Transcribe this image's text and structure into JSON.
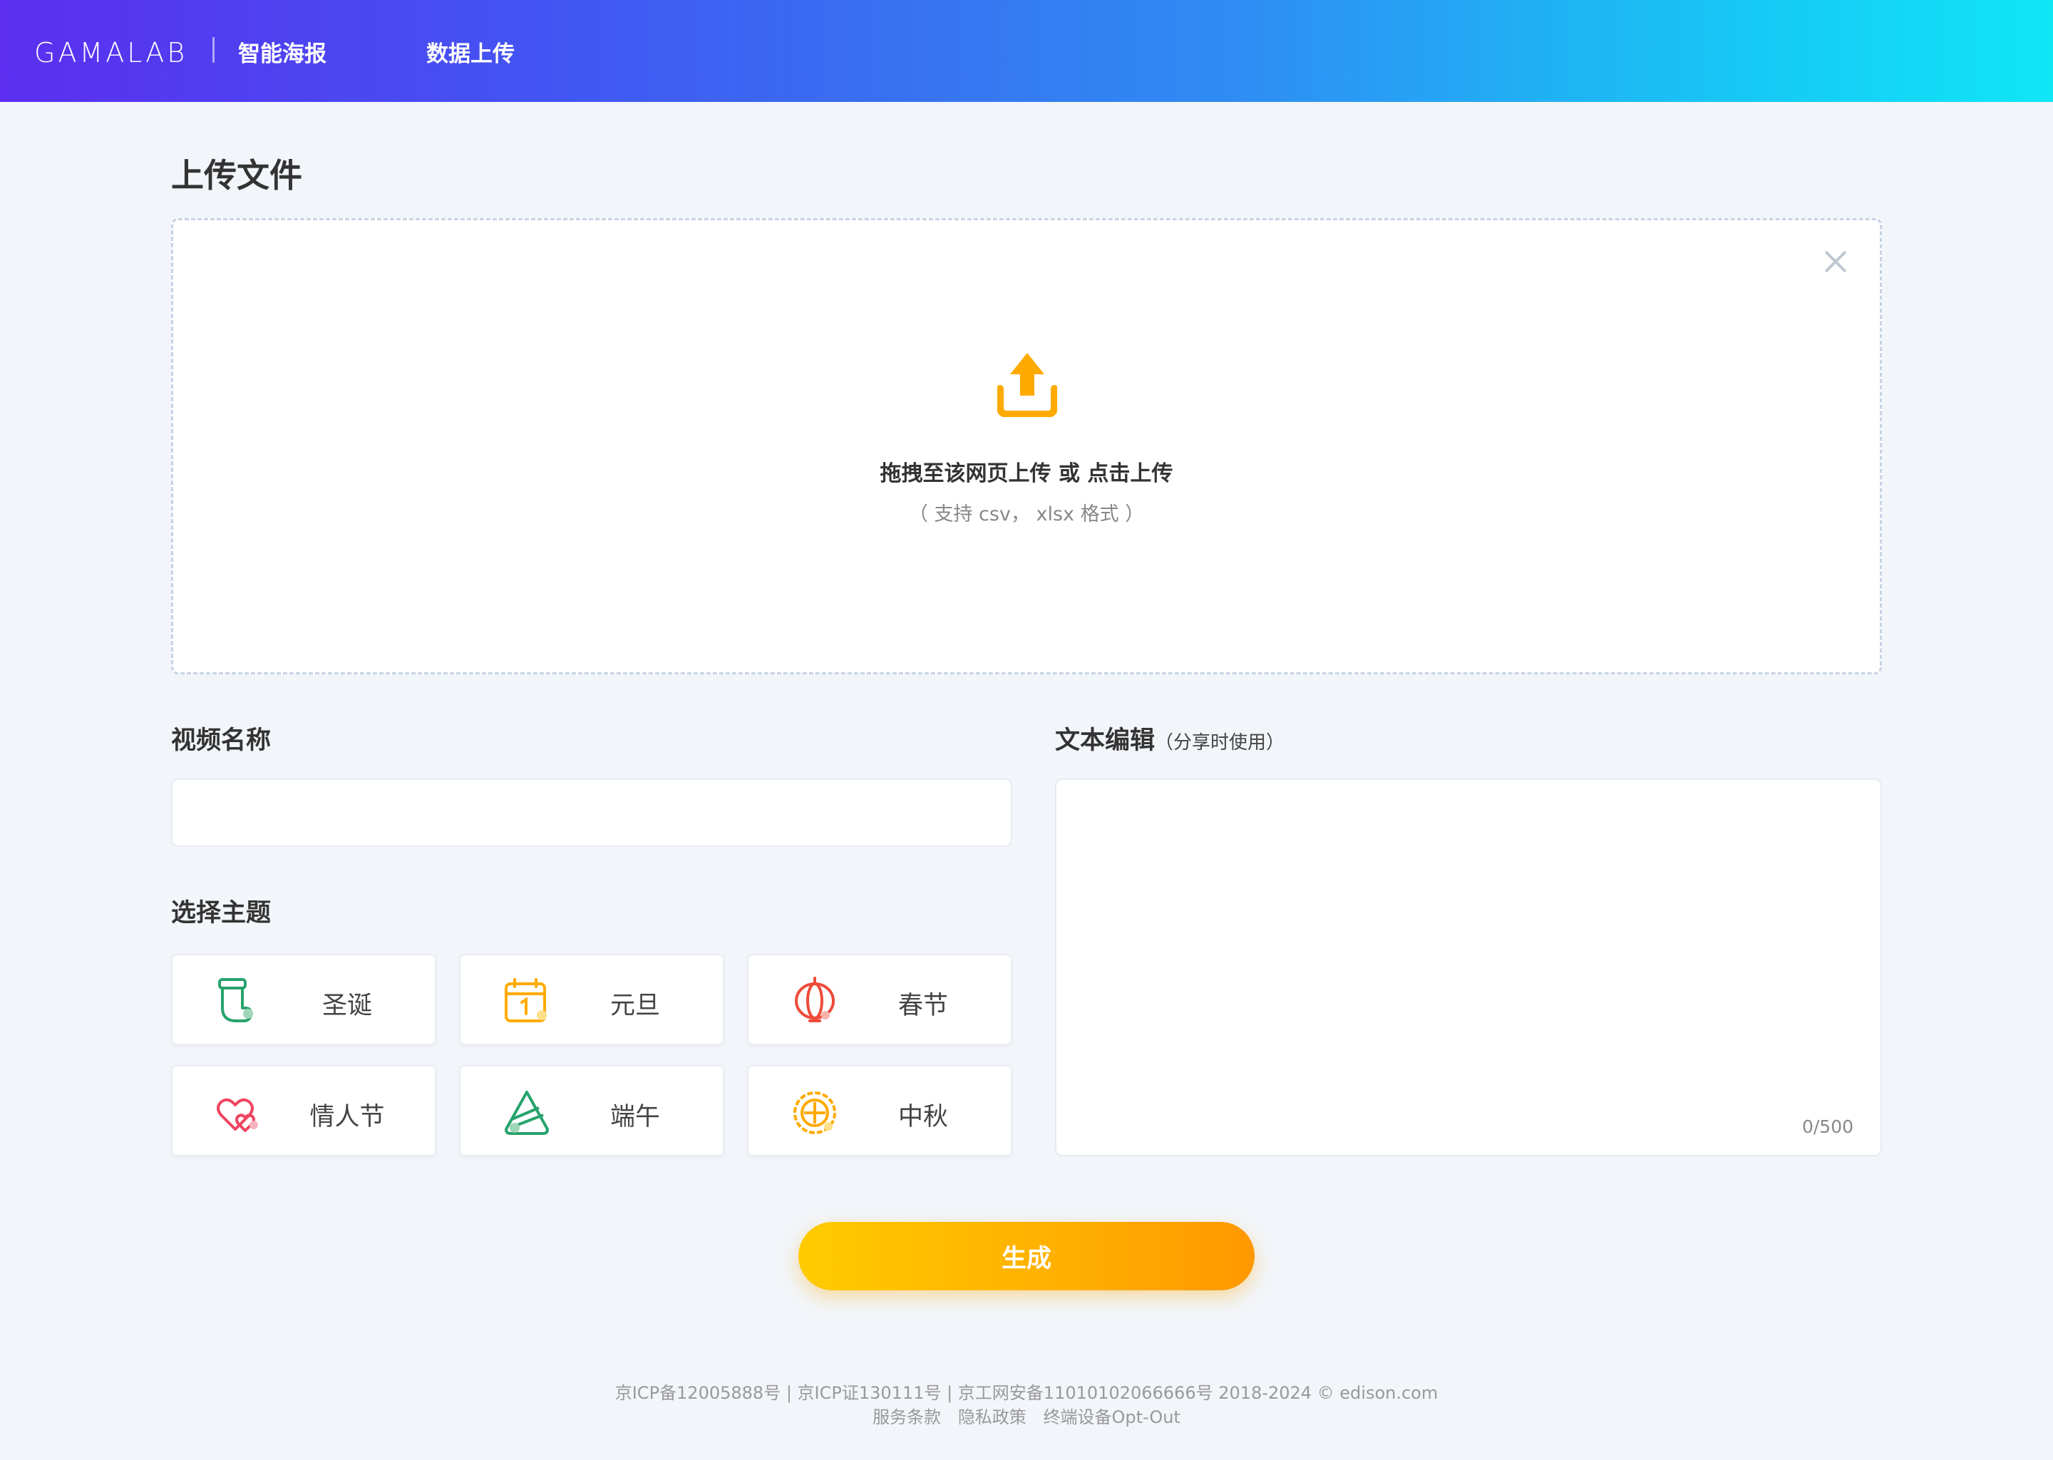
{
  "header": {
    "logo": "GAMALAB",
    "brand": "智能海报",
    "nav_upload": "数据上传"
  },
  "main": {
    "title": "上传文件",
    "dropzone": {
      "hint": "拖拽至该网页上传 或 点击上传",
      "formats": "（ 支持 csv， xlsx 格式 ）",
      "icon": "upload-icon",
      "accent": "#ffaa00"
    },
    "video_name": {
      "label": "视频名称",
      "value": "",
      "placeholder": ""
    },
    "text_edit": {
      "label": "文本编辑",
      "sub": "（分享时使用）",
      "value": "",
      "counter": "0/500"
    },
    "theme": {
      "label": "选择主题",
      "items": [
        {
          "label": "圣诞",
          "icon": "stocking-icon"
        },
        {
          "label": "元旦",
          "icon": "calendar-icon"
        },
        {
          "label": "春节",
          "icon": "lantern-icon"
        },
        {
          "label": "情人节",
          "icon": "hearts-icon"
        },
        {
          "label": "端午",
          "icon": "zongzi-icon"
        },
        {
          "label": "中秋",
          "icon": "mooncake-icon"
        }
      ]
    },
    "generate_label": "生成"
  },
  "footer": {
    "line1": "京ICP备12005888号 | 京ICP证130111号 | 京工网安备11010102066666号 2018-2024 © edison.com",
    "links": [
      "服务条款",
      "隐私政策",
      "终端设备Opt-Out"
    ]
  }
}
